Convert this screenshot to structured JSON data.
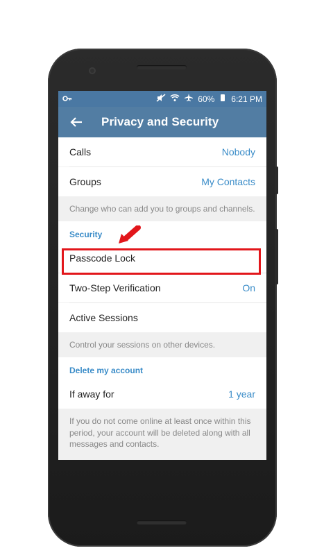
{
  "statusbar": {
    "time": "6:21 PM",
    "battery": "60%",
    "icons": [
      "key-icon",
      "mute-icon",
      "wifi-icon",
      "airplane-icon",
      "battery-icon"
    ]
  },
  "appbar": {
    "title": "Privacy and Security",
    "back_icon": "arrow-left-icon"
  },
  "sections": {
    "privacy": {
      "calls_label": "Calls",
      "calls_value": "Nobody",
      "groups_label": "Groups",
      "groups_value": "My Contacts",
      "groups_info": "Change who can add you to groups and channels."
    },
    "security": {
      "header": "Security",
      "passcode_label": "Passcode Lock",
      "twostep_label": "Two-Step Verification",
      "twostep_value": "On",
      "sessions_label": "Active Sessions",
      "sessions_info": "Control your sessions on other devices."
    },
    "delete": {
      "header": "Delete my account",
      "away_label": "If away for",
      "away_value": "1 year",
      "info": "If you do not come online at least once within this period, your account will be deleted along with all messages and contacts."
    }
  },
  "colors": {
    "accent": "#3a8cc8",
    "appbar": "#527da3",
    "statusbar": "#4a78a3",
    "highlight": "#e2161b"
  }
}
